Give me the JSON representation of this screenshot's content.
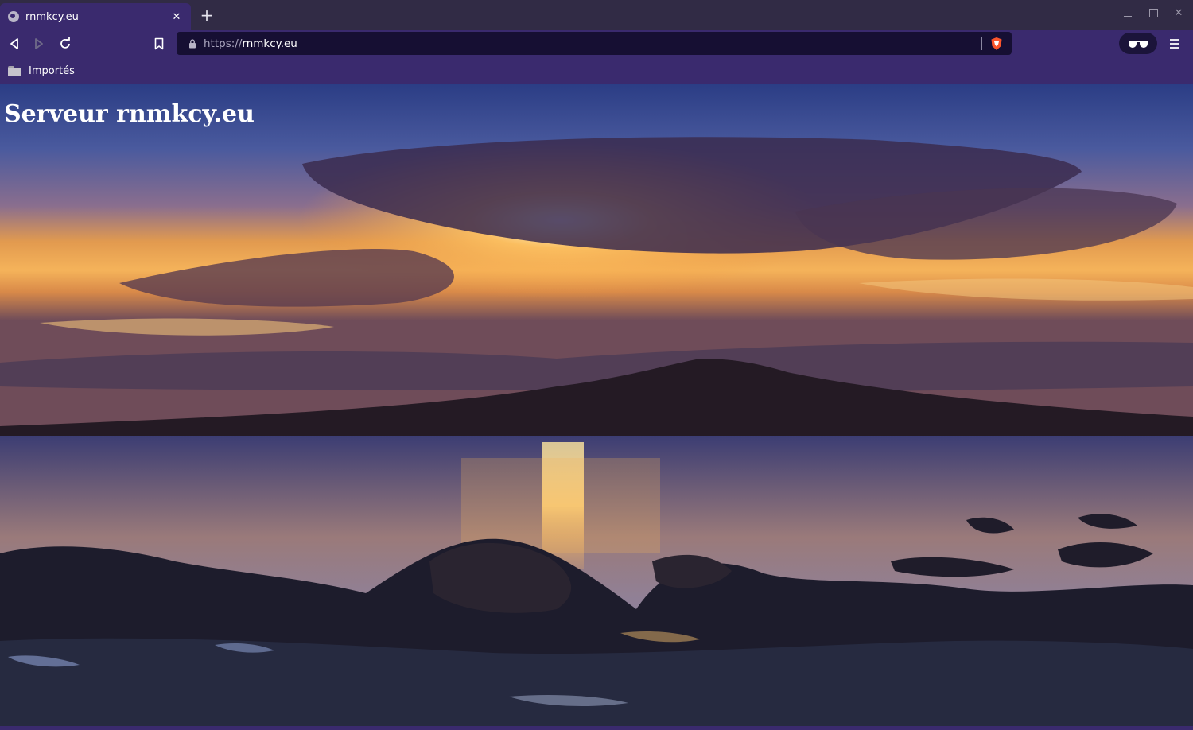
{
  "browser": {
    "tab": {
      "title": "rnmkcy.eu",
      "close_label": "✕"
    },
    "new_tab_label": "+",
    "address": {
      "scheme": "https://",
      "host": "rnmkcy.eu"
    },
    "window_controls": {
      "close_label": "✕"
    },
    "bookmarks_bar": {
      "folder_label": "Importés",
      "folder_icon": "folder-icon"
    },
    "icons": [
      "globe-icon",
      "back-icon",
      "forward-icon",
      "reload-icon",
      "bookmark-icon",
      "lock-icon",
      "brave-shield-icon",
      "private-glasses-icon",
      "menu-icon"
    ]
  },
  "page": {
    "heading": "Serveur rnmkcy.eu",
    "background_image": "sunset over the sea with island silhouette and rocky shore"
  },
  "colors": {
    "toolbar": "#3a2a6e",
    "urlbar": "#160f33",
    "tabstrip": "#312b45",
    "shield": "#fb542b"
  }
}
